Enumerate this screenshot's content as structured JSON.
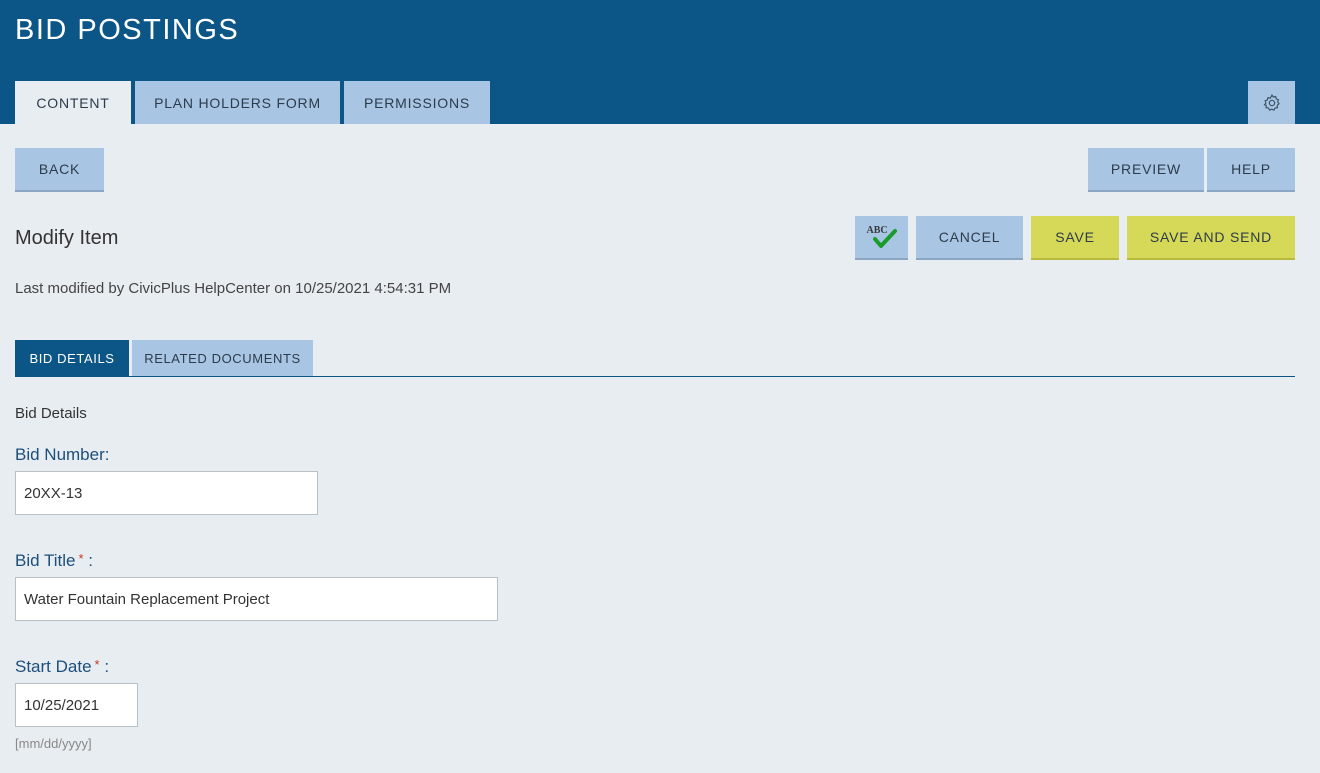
{
  "app": {
    "title": "BID POSTINGS"
  },
  "top_tabs": [
    {
      "label": "CONTENT"
    },
    {
      "label": "PLAN HOLDERS FORM"
    },
    {
      "label": "PERMISSIONS"
    }
  ],
  "toolbar": {
    "back_label": "BACK",
    "preview_label": "PREVIEW",
    "help_label": "HELP"
  },
  "editor": {
    "title": "Modify Item",
    "spellcheck_text": "ABC",
    "cancel_label": "CANCEL",
    "save_label": "SAVE",
    "save_send_label": "SAVE AND SEND",
    "last_modified": "Last modified by CivicPlus HelpCenter on 10/25/2021 4:54:31 PM"
  },
  "sub_tabs": [
    {
      "label": "BID DETAILS"
    },
    {
      "label": "RELATED DOCUMENTS"
    }
  ],
  "form": {
    "group_title": "Bid Details",
    "bid_number": {
      "label": "Bid Number:",
      "value": "20XX-13"
    },
    "bid_title": {
      "label": "Bid Title",
      "required_mark": "*",
      "suffix": " :",
      "value": "Water Fountain Replacement Project"
    },
    "start_date": {
      "label": "Start Date",
      "required_mark": "*",
      "suffix": " :",
      "value": "10/25/2021",
      "hint": "[mm/dd/yyyy]"
    }
  },
  "colors": {
    "header": "#0c5587",
    "tab": "#a8c6e4",
    "accent_yellow": "#d6d958",
    "background": "#e8edf2",
    "label_blue": "#1d4f7c"
  },
  "icons": {
    "settings": "gear-icon",
    "spellcheck": "spellcheck-icon"
  }
}
